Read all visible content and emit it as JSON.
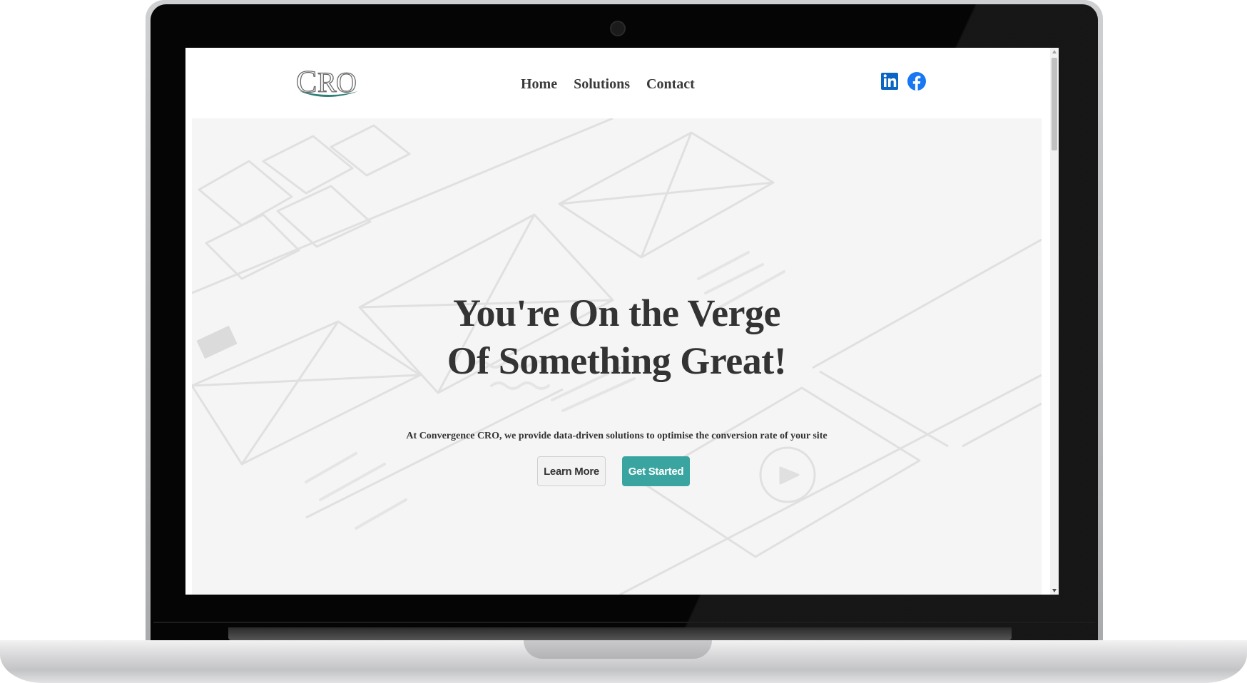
{
  "logo": {
    "text": "CRO"
  },
  "nav": {
    "links": [
      {
        "label": "Home"
      },
      {
        "label": "Solutions"
      },
      {
        "label": "Contact"
      }
    ]
  },
  "socials": [
    {
      "icon": "linkedin-icon",
      "color": "#0a66c2"
    },
    {
      "icon": "facebook-icon",
      "color": "#1877f2"
    }
  ],
  "hero": {
    "title_line1": "You're On the Verge",
    "title_line2": "Of Something Great!",
    "subtitle": "At Convergence CRO, we provide data-driven solutions to optimise the conversion rate of your site",
    "learn_more_label": "Learn More",
    "get_started_label": "Get Started"
  },
  "colors": {
    "accent": "#3aa5a0",
    "text": "#333333"
  }
}
